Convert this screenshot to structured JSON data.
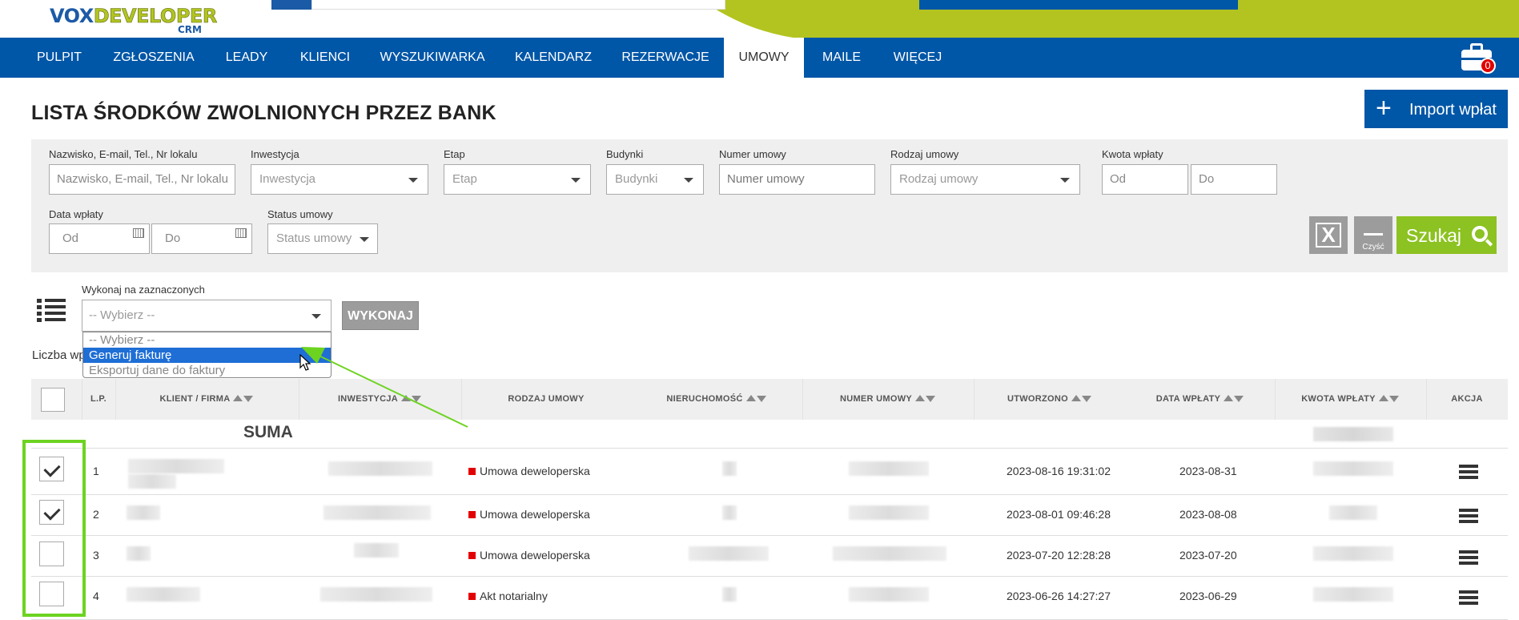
{
  "brand": {
    "logo_main_a": "VOX",
    "logo_main_b": "DEVELOPER",
    "logo_sub": "CRM"
  },
  "nav": {
    "items": [
      "PULPIT",
      "ZGŁOSZENIA",
      "LEADY",
      "KLIENCI",
      "WYSZUKIWARKA",
      "KALENDARZ",
      "REZERWACJE",
      "UMOWY",
      "MAILE",
      "WIĘCEJ"
    ],
    "active": "UMOWY",
    "cart_count": "0"
  },
  "page": {
    "title": "LISTA ŚRODKÓW ZWOLNIONYCH PRZEZ BANK",
    "import_label": "Import wpłat",
    "import_plus": "+"
  },
  "filters": {
    "search_label": "Nazwisko, E-mail, Tel., Nr lokalu",
    "search_placeholder": "Nazwisko, E-mail, Tel., Nr lokalu",
    "investment_label": "Inwestycja",
    "investment_value": "Inwestycja",
    "stage_label": "Etap",
    "stage_value": "Etap",
    "buildings_label": "Budynki",
    "buildings_value": "Budynki",
    "contract_no_label": "Numer umowy",
    "contract_no_placeholder": "Numer umowy",
    "contract_type_label": "Rodzaj umowy",
    "contract_type_value": "Rodzaj umowy",
    "amount_label": "Kwota wpłaty",
    "amount_from": "Od",
    "amount_to": "Do",
    "date_label": "Data wpłaty",
    "date_from": "Od",
    "date_to": "Do",
    "status_label": "Status umowy",
    "status_value": "Status umowy",
    "clear_label": "Czyść",
    "search_button": "Szukaj",
    "excel_glyph": "X"
  },
  "bulk": {
    "label": "Wykonaj na zaznaczonych",
    "select_value": "-- Wybierz --",
    "execute_label": "WYKONAJ",
    "options": [
      "-- Wybierz --",
      "Generuj fakturę",
      "Eksportuj dane do faktury"
    ],
    "highlighted_option": "Generuj fakturę"
  },
  "count_label": "Liczba wp",
  "table": {
    "headers": {
      "lp": "L.P.",
      "client": "KLIENT / FIRMA",
      "investment": "INWESTYCJA",
      "contract_type": "RODZAJ UMOWY",
      "property": "NIERUCHOMOŚĆ",
      "contract_no": "NUMER UMOWY",
      "created": "UTWORZONO",
      "payment_date": "DATA WPŁATY",
      "amount": "KWOTA WPŁATY",
      "action": "AKCJA"
    },
    "sum_label": "SUMA",
    "rows": [
      {
        "lp": "1",
        "checked": true,
        "contract_type": "Umowa deweloperska",
        "created": "2023-08-16 19:31:02",
        "payment_date": "2023-08-31"
      },
      {
        "lp": "2",
        "checked": true,
        "contract_type": "Umowa deweloperska",
        "created": "2023-08-01 09:46:28",
        "payment_date": "2023-08-08"
      },
      {
        "lp": "3",
        "checked": false,
        "contract_type": "Umowa deweloperska",
        "created": "2023-07-20 12:28:28",
        "payment_date": "2023-07-20"
      },
      {
        "lp": "4",
        "checked": false,
        "contract_type": "Akt notarialny",
        "created": "2023-06-26 14:27:27",
        "payment_date": "2023-06-29"
      }
    ]
  },
  "colors": {
    "nav_blue": "#0056a7",
    "brand_lime": "#b3c421",
    "search_green": "#8cc221",
    "highlight_green": "#6dd321",
    "status_red": "#e30000",
    "option_blue": "#1e6ed6"
  },
  "icons": [
    "briefcase-icon",
    "plus-icon",
    "excel-icon",
    "minus-icon",
    "search-icon",
    "calendar-icon",
    "list-icon",
    "sort-icon",
    "checkmark-icon",
    "hamburger-menu-icon",
    "mouse-cursor-icon",
    "green-arrow-icon"
  ]
}
